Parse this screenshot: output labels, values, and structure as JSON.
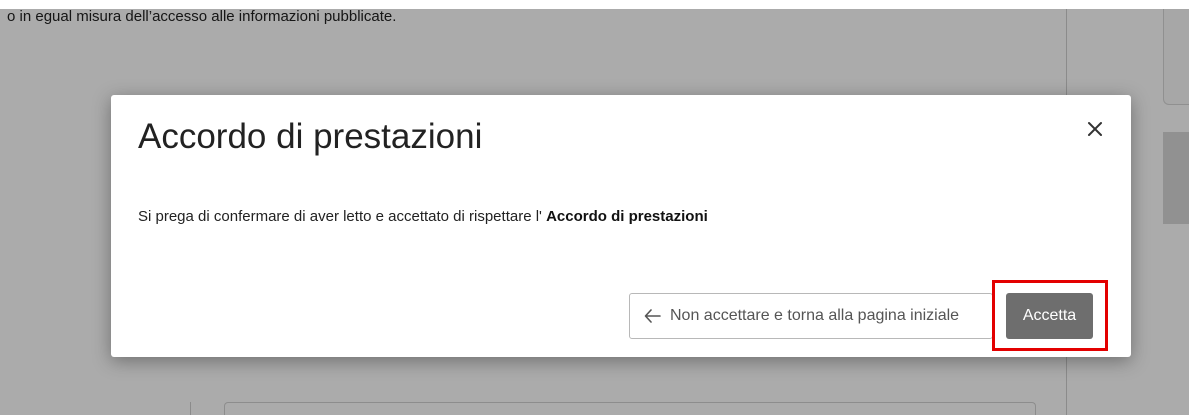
{
  "background": {
    "text": "o in egual misura dell’accesso alle informazioni pubblicate."
  },
  "modal": {
    "title": "Accordo di prestazioni",
    "body_text": "Si prega di confermare di aver letto e accettato di rispettare l' ",
    "body_bold": "Accordo di prestazioni",
    "close_icon": "close-icon",
    "decline_icon": "arrow-left-icon",
    "decline_label": "Non accettare e torna alla pagina iniziale",
    "accept_label": "Accetta"
  },
  "colors": {
    "accept_button": "#6e6e6e",
    "highlight": "#e30000"
  }
}
